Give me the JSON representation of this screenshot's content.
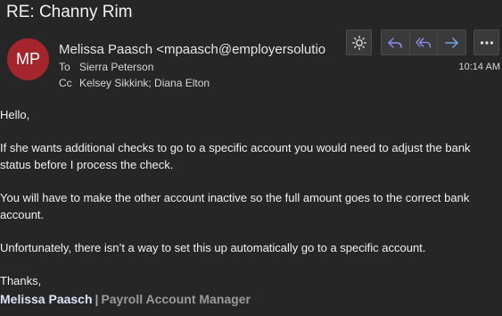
{
  "subject": "RE: Channy Rim",
  "sender": {
    "initials": "MP",
    "display": "Melissa Paasch <mpaasch@employersolution"
  },
  "recipients": {
    "to_label": "To",
    "to": "Sierra Peterson",
    "cc_label": "Cc",
    "cc": "Kelsey Sikkink; Diana Elton"
  },
  "timestamp": "10:14 AM",
  "toolbar": {
    "icons": [
      "sun-icon",
      "reply-icon",
      "reply-all-icon",
      "forward-icon",
      "more-icon"
    ],
    "accent_color": "#8b8ef0"
  },
  "body": {
    "greeting": "Hello,",
    "p1": "If she wants additional checks to go to a specific account you would need to adjust the bank status before I process the check.",
    "p2": "You will have to make the other account inactive so the full amount goes to the correct bank account.",
    "p3": "Unfortunately, there isn’t a way to set this up automatically go to a specific account.",
    "closing": "Thanks,"
  },
  "signature": {
    "name": "Melissa Paasch",
    "separator": "|",
    "title": "Payroll Account Manager"
  },
  "colors": {
    "background": "#262626",
    "avatar": "#a4262c"
  }
}
